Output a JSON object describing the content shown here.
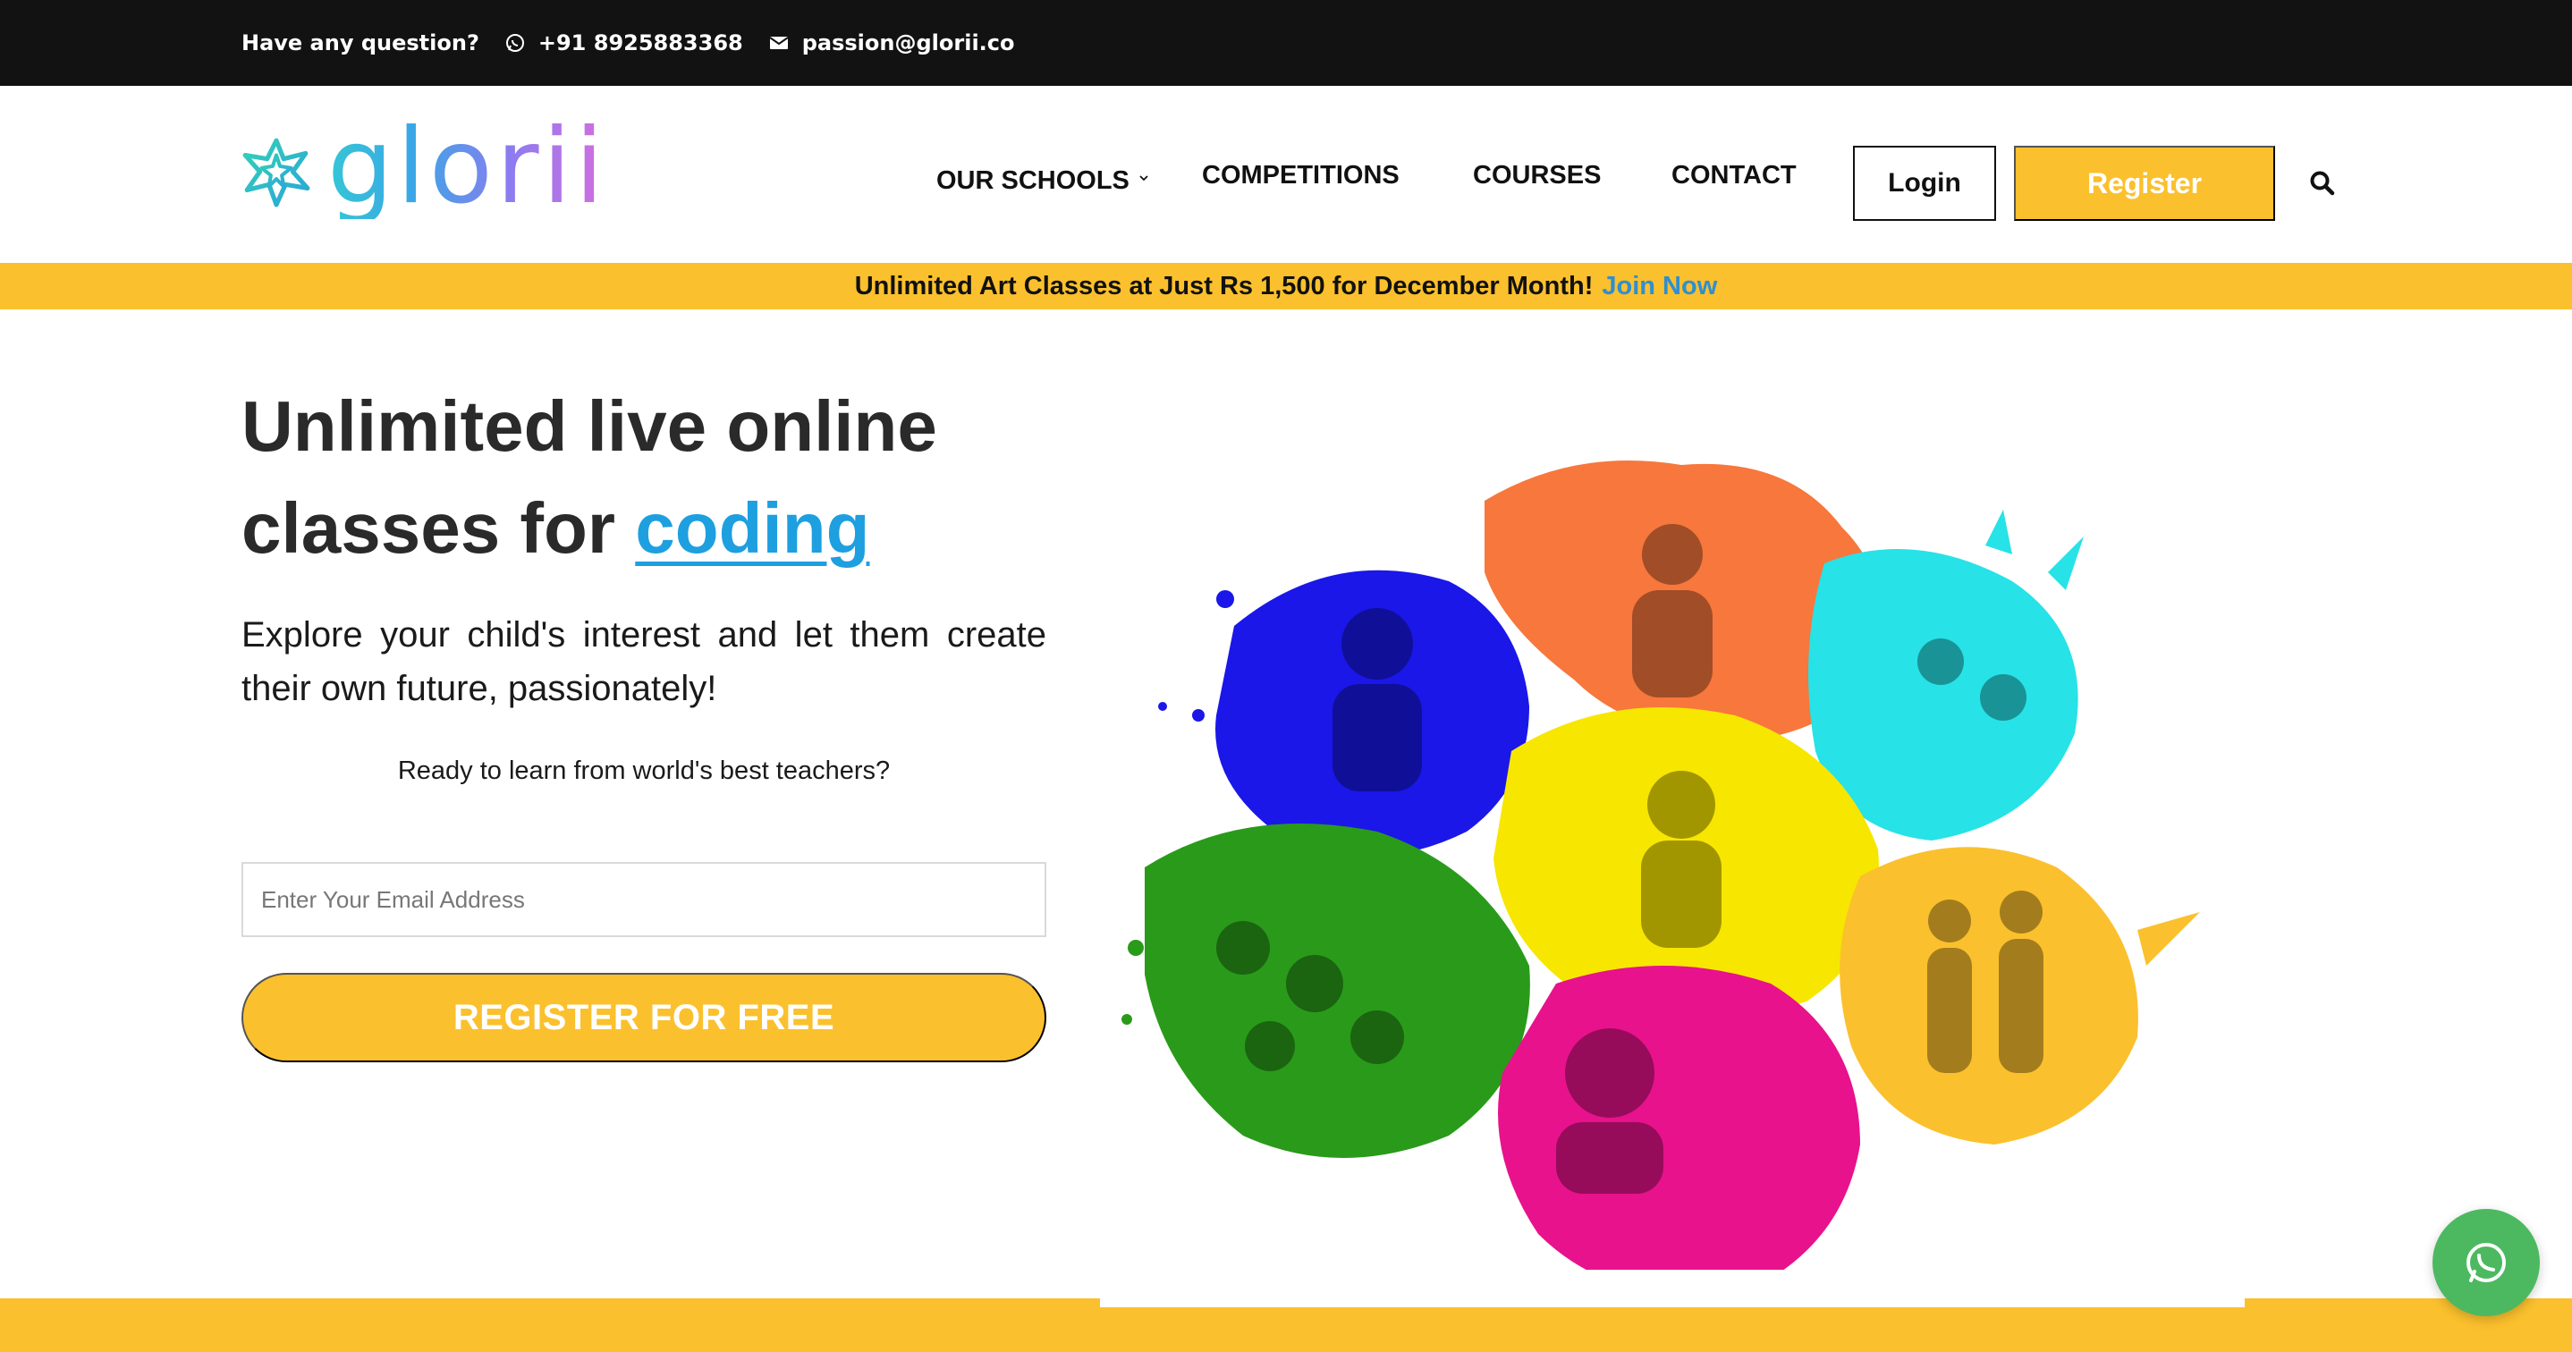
{
  "topbar": {
    "question": "Have any question?",
    "phone": "+91 8925883368",
    "email": "passion@glorii.co",
    "phone_icon": "whatsapp-icon",
    "email_icon": "envelope-icon"
  },
  "header": {
    "logo_text": "glorii",
    "nav": [
      {
        "label": "OUR SCHOOLS",
        "has_dropdown": true
      },
      {
        "label": "COMPETITIONS"
      },
      {
        "label": "COURSES"
      },
      {
        "label": "CONTACT"
      }
    ],
    "login_label": "Login",
    "register_label": "Register",
    "search_icon": "search-icon"
  },
  "promo": {
    "text": "Unlimited Art Classes at Just Rs 1,500 for December Month!",
    "link": "Join Now"
  },
  "hero": {
    "title_line1": "Unlimited live online",
    "title_prefix": "classes for",
    "title_highlight": "coding",
    "subtitle": "Explore your child's interest and let them create their own future, passionately!",
    "ready_text": "Ready to learn from world's best teachers?",
    "email_placeholder": "Enter Your Email Address",
    "cta_label": "REGISTER FOR FREE"
  },
  "colors": {
    "accent_yellow": "#fbc02d",
    "link_blue": "#2f8fd0",
    "highlight_blue": "#1e9fe0",
    "topbar_bg": "#121212",
    "whatsapp_green": "#4cb960"
  },
  "floating": {
    "whatsapp_icon": "whatsapp-icon"
  }
}
